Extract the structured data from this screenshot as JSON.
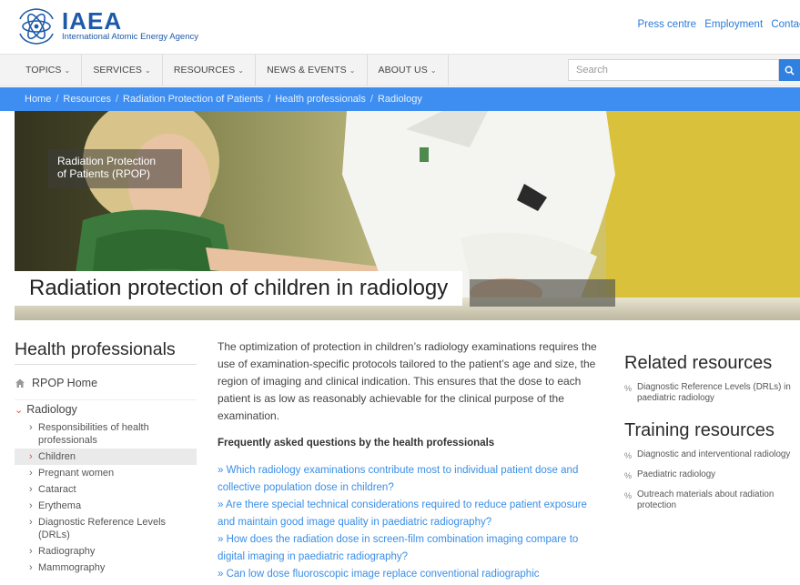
{
  "header": {
    "logo_name": "IAEA",
    "logo_subtitle": "International Atomic Energy Agency",
    "top_links": [
      "Press centre",
      "Employment",
      "Contact"
    ]
  },
  "nav": {
    "items": [
      "TOPICS",
      "SERVICES",
      "RESOURCES",
      "NEWS & EVENTS",
      "ABOUT US"
    ],
    "search_placeholder": "Search"
  },
  "breadcrumb": [
    "Home",
    "Resources",
    "Radiation Protection of Patients",
    "Health professionals",
    "Radiology"
  ],
  "hero": {
    "badge_line1": "Radiation Protection",
    "badge_line2": "of Patients (RPOP)",
    "title": "Radiation protection of children in radiology"
  },
  "sidebar": {
    "title": "Health professionals",
    "home": "RPOP Home",
    "section": "Radiology",
    "items": [
      "Responsibilities of health professionals",
      "Children",
      "Pregnant women",
      "Cataract",
      "Erythema",
      "Diagnostic Reference Levels (DRLs)",
      "Radiography",
      "Mammography"
    ],
    "active_index": 1
  },
  "main": {
    "intro": "The optimization of protection in children’s radiology examinations requires the use of examination-specific protocols tailored to the patient’s age and size, the region of imaging and clinical indication. This ensures that the dose to each patient is as low as reasonably achievable for the clinical purpose of the examination.",
    "faq_heading": "Frequently asked questions by the health professionals",
    "faq": [
      "» Which  radiology examinations contribute most to individual patient dose and collective population dose in children?",
      "» Are there special technical considerations required to reduce patient exposure and maintain good image quality in paediatric radiography?",
      "» How does the radiation dose in screen-film combination imaging compare to digital imaging in paediatric radiography?",
      "» Can low dose fluoroscopic image replace conventional radiographic"
    ]
  },
  "right": {
    "related_title": "Related resources",
    "related": [
      "Diagnostic Reference Levels (DRLs) in paediatric radiology"
    ],
    "training_title": "Training resources",
    "training": [
      "Diagnostic and interventional radiology",
      "Paediatric radiology",
      "Outreach materials about radiation protection"
    ]
  },
  "colors": {
    "brand_blue": "#1e5aa8",
    "breadcrumb_bg": "#3d8ef0",
    "link": "#3a8ee6",
    "search_button": "#2f80e0"
  }
}
